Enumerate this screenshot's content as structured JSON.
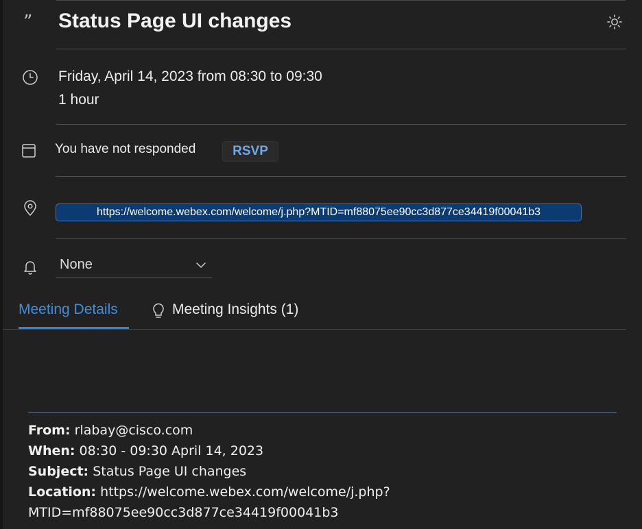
{
  "meeting": {
    "title": "Status Page UI changes",
    "datetime": "Friday, April 14, 2023 from 08:30 to 09:30",
    "duration": "1 hour",
    "response_status": "You have not responded",
    "rsvp_label": "RSVP",
    "location_url": "https://welcome.webex.com/welcome/j.php?MTID=mf88075ee90cc3d877ce34419f00041b3",
    "reminder": "None"
  },
  "icons": {
    "quote": "quote-icon",
    "theme": "sun-icon",
    "time": "clock-icon",
    "calendar": "calendar-icon",
    "location": "location-pin-icon",
    "reminder": "bell-icon",
    "insights": "lightbulb-icon",
    "dropdown": "chevron-down-icon"
  },
  "tabs": [
    {
      "label": "Meeting Details",
      "active": true
    },
    {
      "label": "Meeting Insights (1)",
      "active": false
    }
  ],
  "details": {
    "from_label": "From:",
    "from_value": "rlabay@cisco.com",
    "when_label": "When:",
    "when_value": "08:30 - 09:30 April 14, 2023",
    "subject_label": "Subject:",
    "subject_value": "Status Page UI changes",
    "location_label": "Location:",
    "location_value_line1": "https://welcome.webex.com/welcome/j.php?",
    "location_value_line2": "MTID=mf88075ee90cc3d877ce34419f00041b3"
  },
  "colors": {
    "background": "#212121",
    "accent_blue": "#2f86dd",
    "link_pill_bg": "#0c3b72",
    "rsvp_text": "#6ea8e8"
  }
}
